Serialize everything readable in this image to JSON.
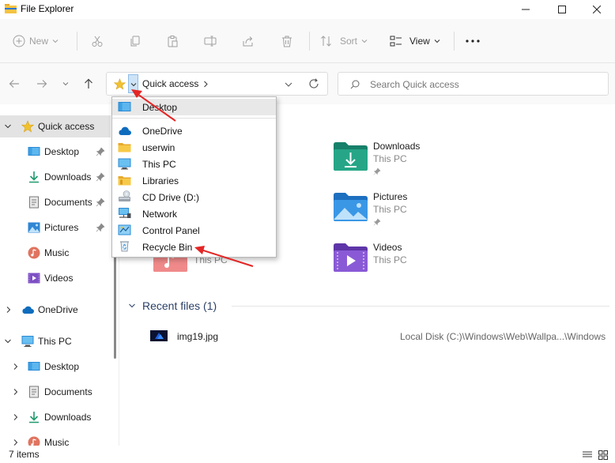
{
  "window": {
    "title": "File Explorer"
  },
  "toolbar": {
    "new_label": "New",
    "sort_label": "Sort",
    "view_label": "View"
  },
  "address": {
    "current": "Quick access",
    "search_placeholder": "Search Quick access"
  },
  "dropdown": {
    "items": [
      "Desktop",
      "OneDrive",
      "userwin",
      "This PC",
      "Libraries",
      "CD Drive (D:)",
      "Network",
      "Control Panel",
      "Recycle Bin"
    ]
  },
  "sidebar": {
    "quick_access": "Quick access",
    "quick_items": [
      "Desktop",
      "Downloads",
      "Documents",
      "Pictures",
      "Music",
      "Videos"
    ],
    "onedrive": "OneDrive",
    "this_pc": "This PC",
    "pc_items": [
      "Desktop",
      "Documents",
      "Downloads",
      "Music"
    ]
  },
  "folders": [
    {
      "name": "Downloads",
      "location": "This PC"
    },
    {
      "name": "Pictures",
      "location": "This PC"
    },
    {
      "name": "Videos",
      "location": "This PC"
    },
    {
      "location": "This PC"
    }
  ],
  "recent": {
    "header": "Recent files (1)",
    "files": [
      {
        "name": "img19.jpg",
        "path": "Local Disk (C:)\\Windows\\Web\\Wallpa...\\Windows"
      }
    ]
  },
  "status": {
    "items_count": "7 items"
  },
  "colors": {
    "accent": "#0067c0",
    "annotation": "#e32626",
    "selection": "#e3e3e3"
  }
}
